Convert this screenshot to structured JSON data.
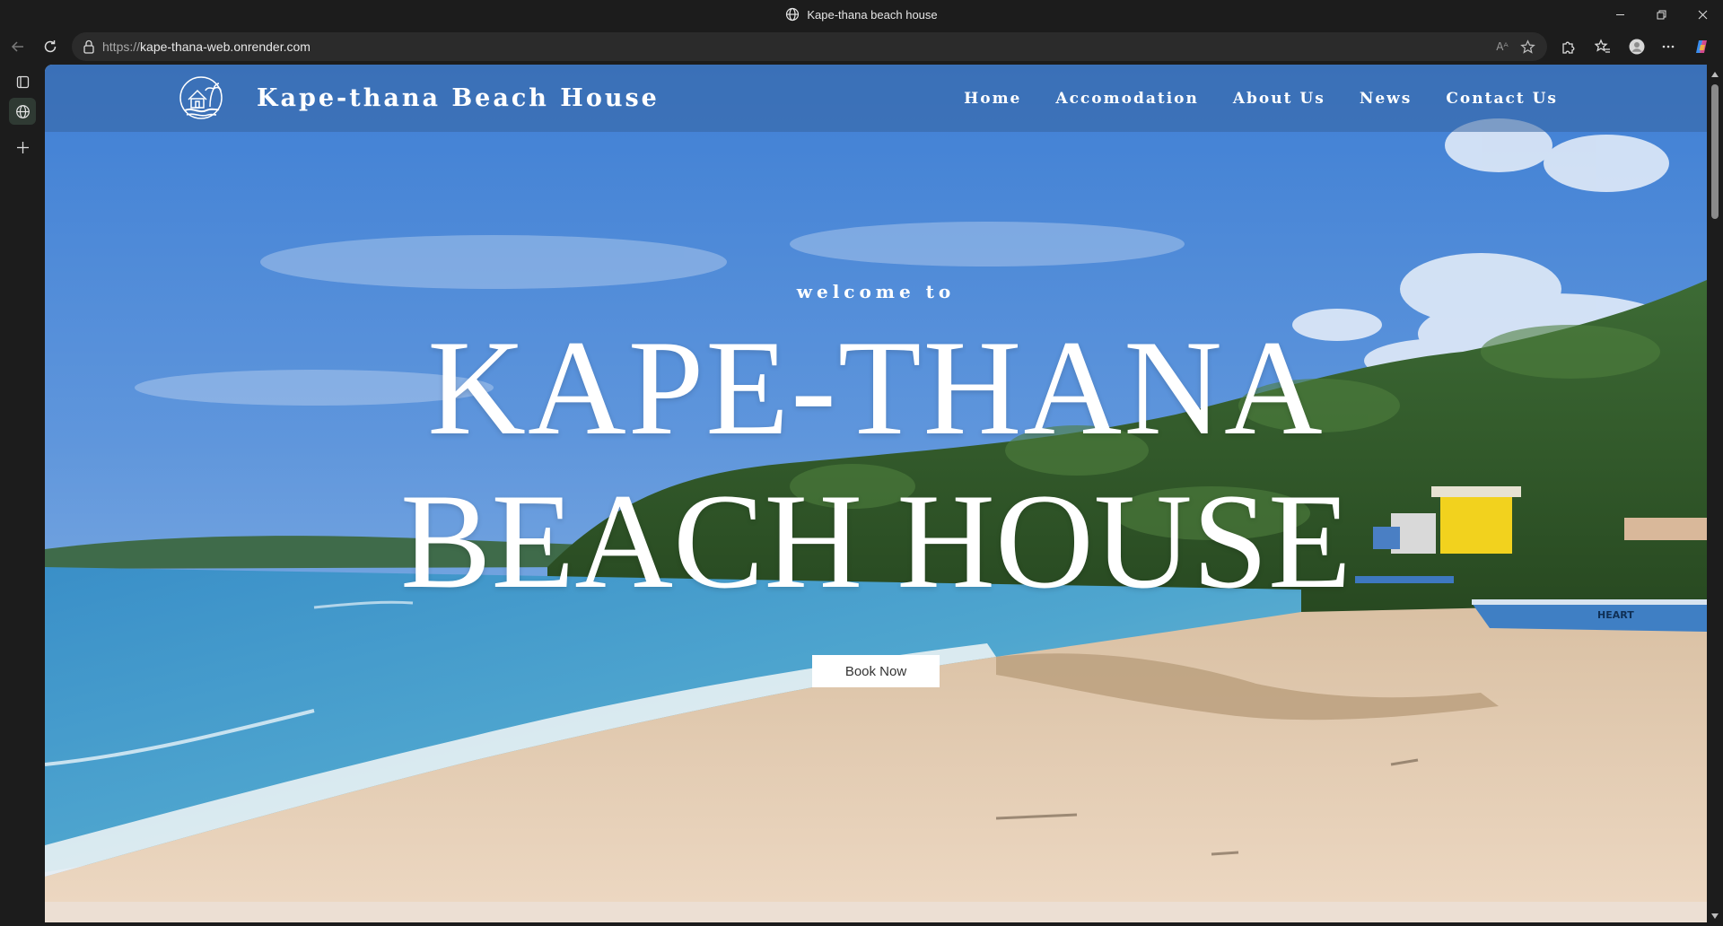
{
  "window": {
    "title": "Kape-thana beach house"
  },
  "toolbar": {
    "url_scheme": "https://",
    "url_host": "kape-thana-web.onrender.com",
    "read_aloud": "Aᴬ"
  },
  "site": {
    "brand": "Kape-thana Beach House",
    "nav": [
      "Home",
      "Accomodation",
      "About Us",
      "News",
      "Contact Us"
    ],
    "hero": {
      "welcome": "welcome to",
      "title_line1": "KAPE-THANA",
      "title_line2": "BEACH HOUSE",
      "cta": "Book Now",
      "boat_text": "HEART"
    }
  },
  "colors": {
    "browser_chrome": "#1c1c1c",
    "header_overlay": "#3664a0",
    "sky": "#4a86d6",
    "sand": "#e4cbb0",
    "sea": "#3f8fc6"
  }
}
